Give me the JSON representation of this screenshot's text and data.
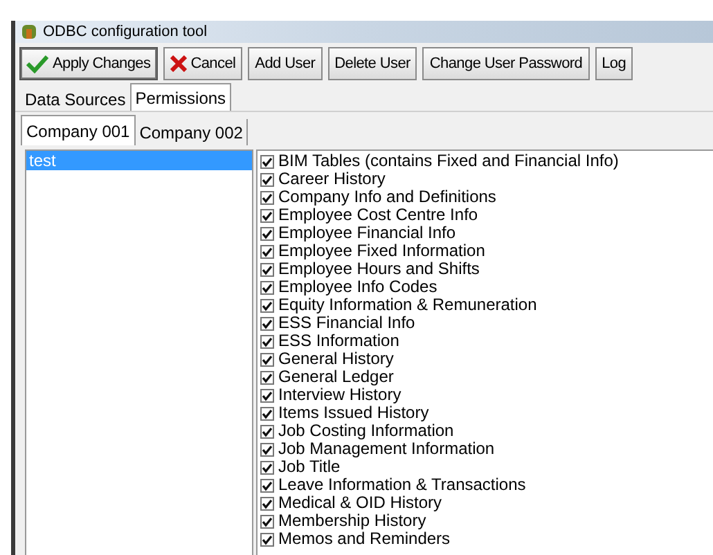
{
  "window": {
    "title": "ODBC configuration tool"
  },
  "toolbar": [
    {
      "kind": "apply",
      "label": "Apply Changes"
    },
    {
      "kind": "cancel",
      "label": "Cancel"
    },
    {
      "kind": "plain",
      "label": "Add User"
    },
    {
      "kind": "plain",
      "label": "Delete User"
    },
    {
      "kind": "plain",
      "label": "Change User Password"
    },
    {
      "kind": "plain",
      "label": "Log"
    }
  ],
  "tabs": [
    {
      "label": "Data Sources",
      "selected": false
    },
    {
      "label": "Permissions",
      "selected": true
    }
  ],
  "company_tabs": [
    {
      "label": "Company 001",
      "selected": true
    },
    {
      "label": "Company 002",
      "selected": false
    }
  ],
  "users": [
    {
      "name": "test",
      "selected": true
    }
  ],
  "permissions": [
    {
      "label": "BIM Tables (contains Fixed and Financial Info)",
      "checked": true
    },
    {
      "label": "Career History",
      "checked": true
    },
    {
      "label": "Company Info and Definitions",
      "checked": true
    },
    {
      "label": "Employee Cost Centre Info",
      "checked": true
    },
    {
      "label": "Employee Financial Info",
      "checked": true
    },
    {
      "label": "Employee Fixed Information",
      "checked": true
    },
    {
      "label": "Employee Hours and Shifts",
      "checked": true
    },
    {
      "label": "Employee Info Codes",
      "checked": true
    },
    {
      "label": "Equity Information & Remuneration",
      "checked": true
    },
    {
      "label": "ESS Financial Info",
      "checked": true
    },
    {
      "label": "ESS Information",
      "checked": true
    },
    {
      "label": "General History",
      "checked": true
    },
    {
      "label": "General Ledger",
      "checked": true
    },
    {
      "label": "Interview History",
      "checked": true
    },
    {
      "label": "Items Issued History",
      "checked": true
    },
    {
      "label": "Job Costing Information",
      "checked": true
    },
    {
      "label": "Job Management Information",
      "checked": true
    },
    {
      "label": "Job Title",
      "checked": true
    },
    {
      "label": "Leave Information & Transactions",
      "checked": true
    },
    {
      "label": "Medical & OID History",
      "checked": true
    },
    {
      "label": "Membership History",
      "checked": true
    },
    {
      "label": "Memos and Reminders",
      "checked": true
    }
  ]
}
